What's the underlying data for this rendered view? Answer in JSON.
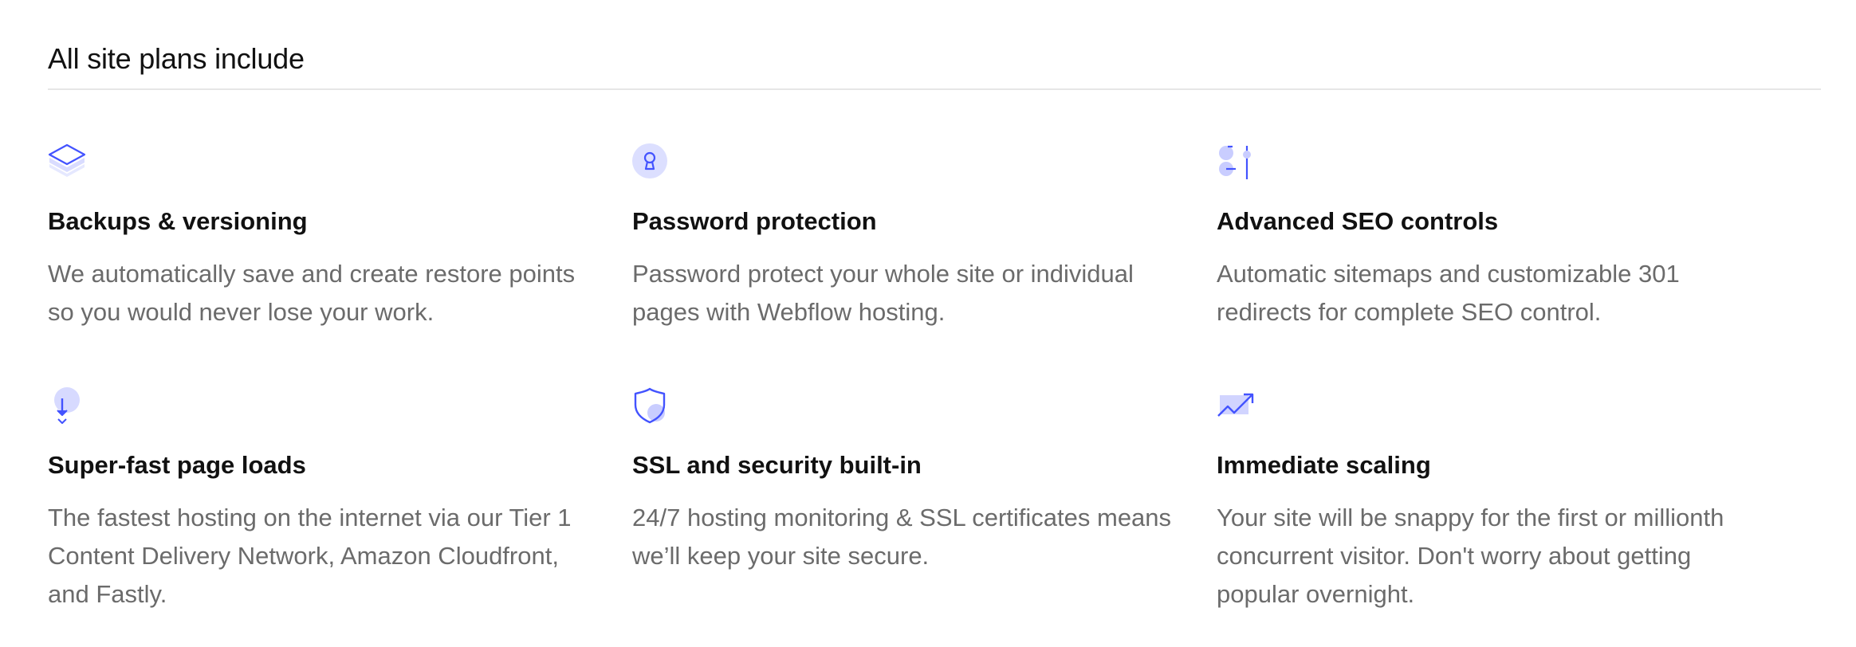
{
  "section": {
    "title": "All site plans include"
  },
  "colors": {
    "accent": "#4353ff",
    "accent_light": "#d9dcff",
    "title_text": "#111111",
    "body_text": "#6b6b6b",
    "divider": "#e6e6e6"
  },
  "features": [
    {
      "icon": "layers-icon",
      "title": "Backups & versioning",
      "description": "We automatically save and create restore points so you would never lose your work."
    },
    {
      "icon": "keyhole-icon",
      "title": "Password protection",
      "description": "Password protect your whole site or individual pages with Webflow hosting."
    },
    {
      "icon": "sliders-icon",
      "title": "Advanced SEO controls",
      "description": "Automatic sitemaps and customizable 301 redirects for complete SEO control."
    },
    {
      "icon": "download-arrow-icon",
      "title": "Super-fast page loads",
      "description": "The fastest hosting on the internet via our Tier 1 Content Delivery Network, Amazon Cloudfront, and Fastly."
    },
    {
      "icon": "shield-icon",
      "title": "SSL and security built-in",
      "description": "24/7 hosting monitoring & SSL certificates means we’ll keep your site secure."
    },
    {
      "icon": "trending-up-icon",
      "title": "Immediate scaling",
      "description": "Your site will be snappy for the first or millionth concurrent visitor. Don't worry about getting popular overnight."
    }
  ]
}
